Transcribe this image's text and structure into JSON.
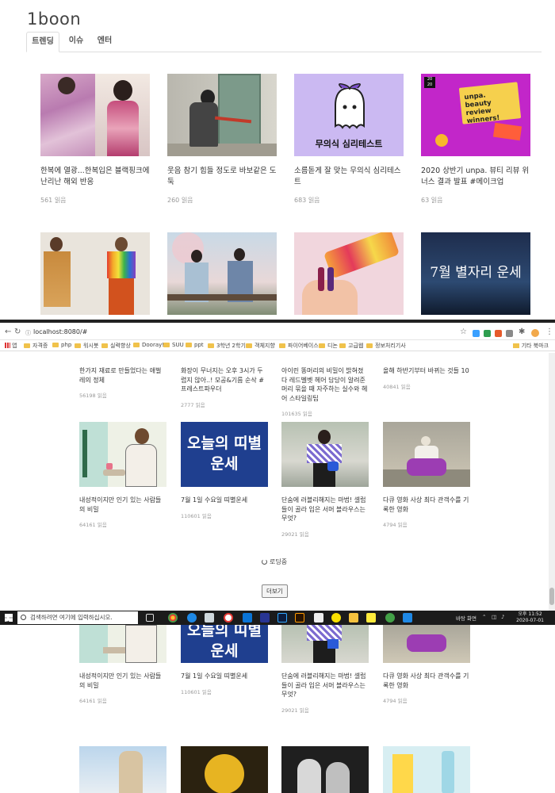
{
  "site": {
    "logo": "1boon",
    "tabs": [
      "트렌딩",
      "이슈",
      "엔터"
    ]
  },
  "grid1": [
    {
      "title": "한복에 열광...한복입은 블랙핑크에 난리난 해외 반응",
      "views": "561 읽음",
      "thumb": "hanbok-photo"
    },
    {
      "title": "웃음 참기 힘들 정도로 바보같은 도둑",
      "views": "260 읽음",
      "thumb": "thief-photo"
    },
    {
      "title": "소름돋게 잘 맞는 무의식 심리테스트",
      "views": "683 읽음",
      "thumb": "ghost-illustration",
      "thumb_text": "무의식 심리테스트"
    },
    {
      "title": "2020 상반기 unpa. 뷰티 리뷰 위너스 결과 발표 #메이크업",
      "views": "63 읽음",
      "thumb": "beauty-review-poster",
      "thumb_text": "unpa. beauty review winners!"
    }
  ],
  "grid1_row2": [
    {
      "thumb": "fashion-models-photo"
    },
    {
      "thumb": "drama-couple-photo"
    },
    {
      "thumb": "jelly-candy-photo"
    },
    {
      "thumb": "night-sky-photo",
      "thumb_text": "7월 별자리 운세"
    }
  ],
  "browser": {
    "url": "localhost:8080/#",
    "bookmarks": [
      "앱",
      "자격증",
      "php",
      "워시봇",
      "실력향상",
      "Dooray!",
      "SUU",
      "ppt",
      "3학년 2학기",
      "객체지향",
      "파이어베이스",
      "디논",
      "고급웹",
      "정보처리기사"
    ],
    "bookmarks_right": "기타 북마크"
  },
  "grid2_top": [
    {
      "title": "한가지 재료로 만들었다는 애벌레의 정체",
      "views": "56198 읽음"
    },
    {
      "title": "화장이 무너지는 오후 3시가 두렵지 않아..! 모공&기름 순삭 #프레스트파우더",
      "views": "2777 읽음"
    },
    {
      "title": "아이린 똥머리의 비밀이 밝혀졌다 레드벨벳 헤어 담당이 알려준 머리 묶을 때 자주하는 실수와 헤어 스타일링팁",
      "views": "101635 읽음"
    },
    {
      "title": "올해 하반기부터 바뀌는 것들 10",
      "views": "40841 읽음"
    }
  ],
  "grid2": [
    {
      "title": "내성적이지만 인기 있는 사람들의 비밀",
      "views": "64161 읽음",
      "thumb": "woman-coffee-illustration"
    },
    {
      "title": "7월 1일 수요일 띠별운세",
      "views": "110601 읽음",
      "thumb": "fortune-banner",
      "thumb_text": "오늘의 띠별운세"
    },
    {
      "title": "단숨에 러블리해지는 마법! 셀럽들이 골라 입은 서머 블라우스는 무엇?",
      "views": "29021 읽음",
      "thumb": "celeb-blouse-photo"
    },
    {
      "title": "다큐 영화 사상 최다 관객수를 기록한 영화",
      "views": "4794 읽음",
      "thumb": "elderly-couple-photo"
    }
  ],
  "loading_text": "로딩중",
  "more_button": "더보기",
  "taskbar": {
    "search_placeholder": "검색하려면 여기에 입력하십시오.",
    "desktop_label": "바탕 화면",
    "time": "오후 11:52",
    "date": "2020-07-01"
  },
  "colors": {
    "tab_border": "#dddddd",
    "views": "#999999",
    "fortune_blue": "#1f3f8f",
    "taskbar": "#1b1b1b"
  }
}
